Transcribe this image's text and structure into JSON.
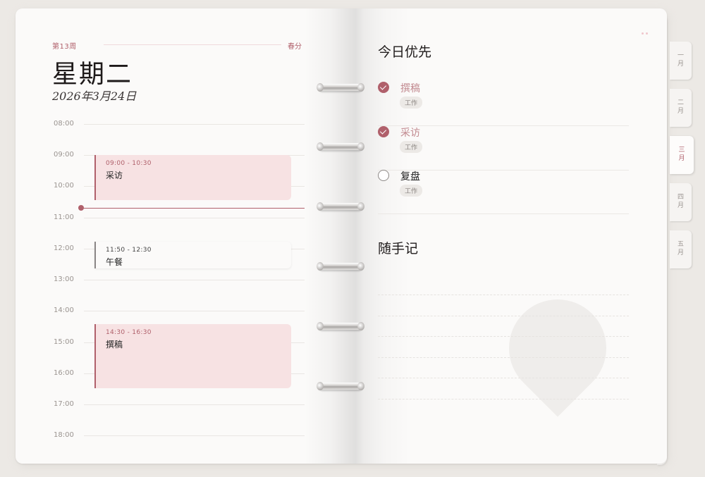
{
  "left_page": {
    "week": "第13周",
    "season": "春分",
    "day_title": "星期二",
    "date": "2026年3月24日",
    "hours": [
      "08:00",
      "09:00",
      "10:00",
      "11:00",
      "12:00",
      "13:00",
      "14:00",
      "15:00",
      "16:00",
      "17:00",
      "18:00"
    ],
    "events": [
      {
        "time": "09:00 - 10:30",
        "title": "采访"
      },
      {
        "time": "11:50 - 12:30",
        "title": "午餐"
      },
      {
        "time": "14:30 - 16:30",
        "title": "撰稿"
      }
    ]
  },
  "right_page": {
    "priorities_title": "今日优先",
    "priorities": [
      {
        "label": "撰稿",
        "tag": "工作",
        "done": true
      },
      {
        "label": "采访",
        "tag": "工作",
        "done": true
      },
      {
        "label": "复盘",
        "tag": "工作",
        "done": false
      }
    ],
    "notes_title": "随手记"
  },
  "month_tabs": [
    {
      "top": "一",
      "bottom": "月"
    },
    {
      "top": "二",
      "bottom": "月"
    },
    {
      "top": "三",
      "bottom": "月",
      "active": true
    },
    {
      "top": "四",
      "bottom": "月"
    },
    {
      "top": "五",
      "bottom": "月"
    }
  ],
  "colors": {
    "accent": "#b0606b",
    "event_fill": "#f7e2e3",
    "paper": "#fbfaf9"
  }
}
